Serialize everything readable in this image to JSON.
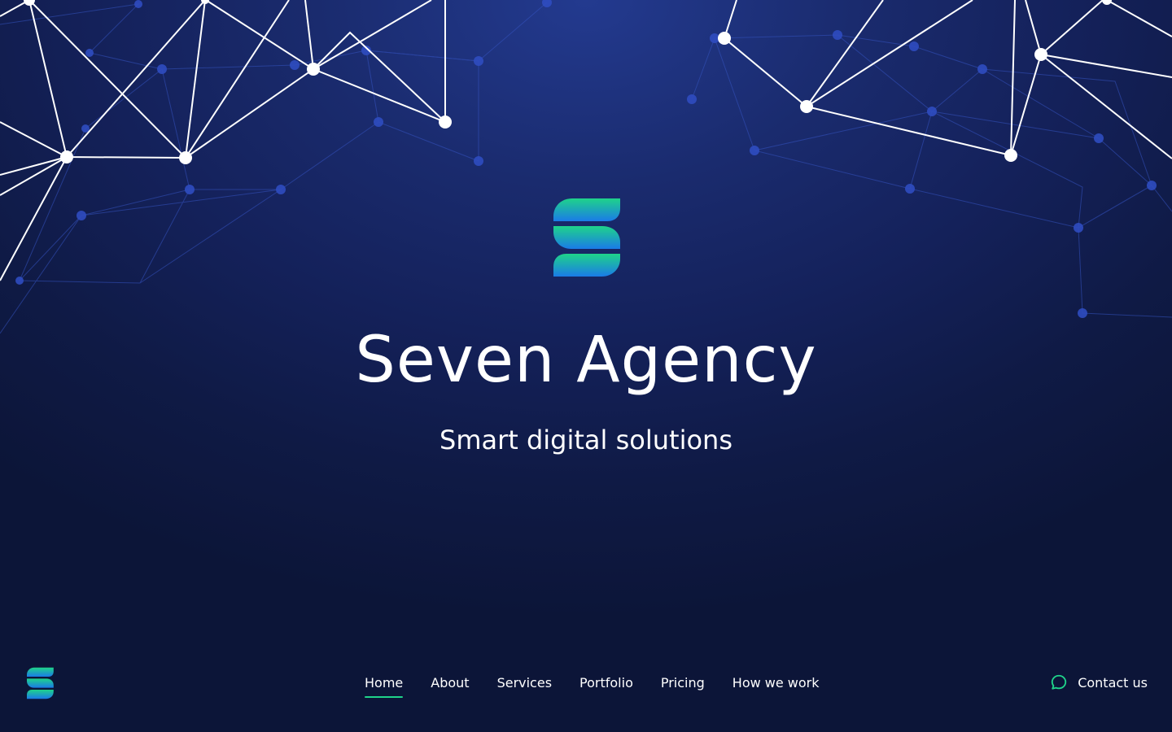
{
  "brand": {
    "name": "Seven Agency",
    "tagline": "Smart digital solutions",
    "logo_icon": "seven-agency-s-logo",
    "gradient": [
      "#1fd38a",
      "#1a7be8"
    ]
  },
  "nav": {
    "items": [
      {
        "label": "Home",
        "active": true
      },
      {
        "label": "About",
        "active": false
      },
      {
        "label": "Services",
        "active": false
      },
      {
        "label": "Portfolio",
        "active": false
      },
      {
        "label": "Pricing",
        "active": false
      },
      {
        "label": "How we work",
        "active": false
      }
    ],
    "active_underline_color": "#1fd38a"
  },
  "contact": {
    "label": "Contact us",
    "icon": "chat-bubble-icon",
    "icon_color": "#1fd38a"
  },
  "colors": {
    "background": "#14215a",
    "text": "#ffffff",
    "network_line": "#ffffff",
    "network_faint": "#3a55c4"
  }
}
